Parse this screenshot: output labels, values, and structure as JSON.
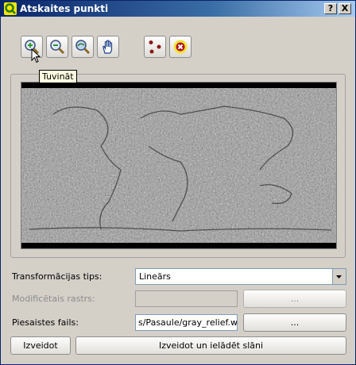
{
  "window": {
    "title": "Atskaites punkti",
    "help_label": "?",
    "close_label": "X"
  },
  "toolbar": {
    "tools": [
      {
        "name": "zoom-in",
        "icon": "zoom-in-icon"
      },
      {
        "name": "zoom-out",
        "icon": "zoom-out-icon"
      },
      {
        "name": "zoom-to-layer",
        "icon": "zoom-full-icon"
      },
      {
        "name": "pan",
        "icon": "pan-hand-icon"
      },
      {
        "name": "add-point",
        "icon": "add-point-icon"
      },
      {
        "name": "delete-point",
        "icon": "delete-point-icon"
      }
    ],
    "tooltip": "Tuvināt"
  },
  "map": {
    "content": "grayscale-world-relief-raster"
  },
  "form": {
    "transform_label": "Transformācijas tips:",
    "transform_value": "Lineārs",
    "modified_raster_label": "Modificētais rastrs:",
    "modified_raster_value": "",
    "modified_raster_browse": "...",
    "world_file_label": "Piesaistes fails:",
    "world_file_value": "s/Pasaule/gray_relief.wld",
    "world_file_browse": "..."
  },
  "buttons": {
    "create": "Izveidot",
    "create_and_load": "Izveidot un ielādēt slāni"
  },
  "colors": {
    "titlebar": "#0a246a",
    "window_bg": "#d4d0c8",
    "tooltip_bg": "#ffffe1",
    "point_red": "#8b1a1a"
  }
}
